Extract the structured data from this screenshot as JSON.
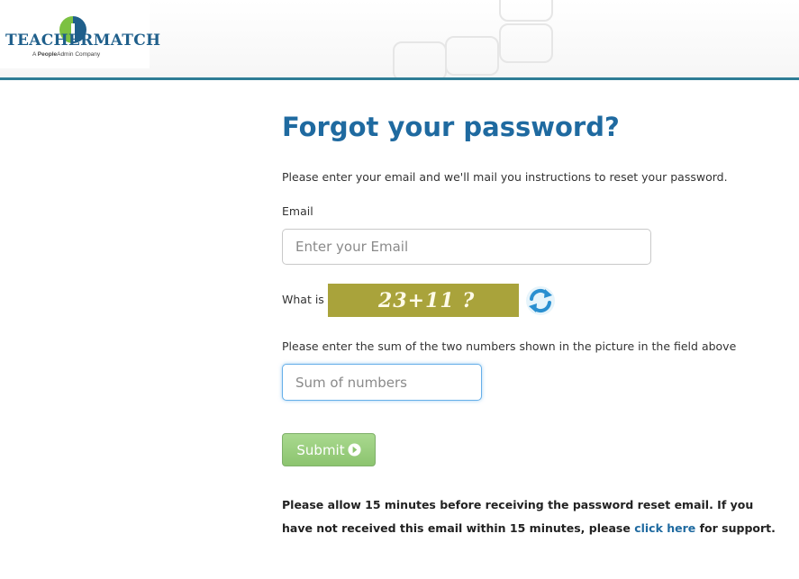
{
  "header": {
    "logo_text": "TEACHERMATCH",
    "logo_sub_prefix": "A ",
    "logo_sub_brand": "People",
    "logo_sub_suffix": "Admin Company",
    "brand_color": "#1f5f8b",
    "border_color": "#2f7d96"
  },
  "form": {
    "title": "Forgot your password?",
    "intro": "Please enter your email and we'll mail you instructions to reset your password.",
    "email_label": "Email",
    "email_placeholder": "Enter your Email",
    "captcha_label": "What is",
    "captcha_text": "23+11 ?",
    "captcha_color": "#a9a33b",
    "refresh_icon": "refresh-icon",
    "sum_hint": "Please enter the sum of the two numbers shown in the picture in the field above",
    "sum_placeholder": "Sum of numbers",
    "submit_label": "Submit",
    "submit_color": "#8cc46f"
  },
  "notice": {
    "text_before": "Please allow 15 minutes before receiving the password reset email. If you have not received this email within 15 minutes, please ",
    "link_text": "click here",
    "text_after": " for support.",
    "link_color": "#1f6aa0"
  }
}
